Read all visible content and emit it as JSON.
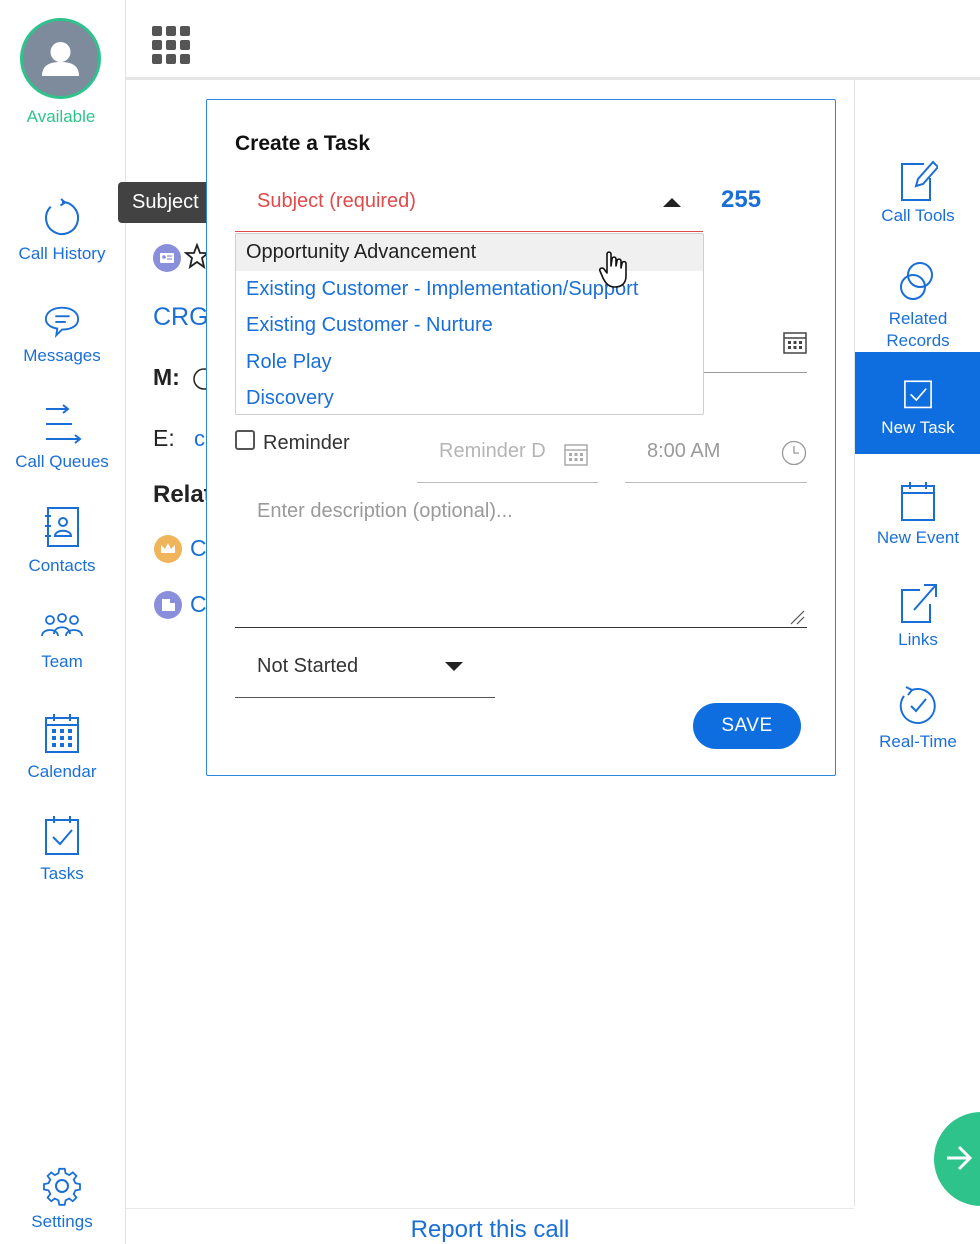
{
  "user": {
    "status": "Available"
  },
  "left_nav": {
    "call_history": "Call History",
    "messages": "Messages",
    "call_queues": "Call Queues",
    "contacts": "Contacts",
    "team": "Team",
    "calendar": "Calendar",
    "tasks": "Tasks",
    "settings": "Settings"
  },
  "right_nav": {
    "call_tools": "Call Tools",
    "related_records_1": "Related",
    "related_records_2": "Records",
    "new_task": "New Task",
    "new_event": "New Event",
    "links": "Links",
    "real_time": "Real-Time"
  },
  "background": {
    "crg": "CRG",
    "m_label": "M:",
    "e_label": "E:",
    "e_value": "c",
    "related_heading": "Relat",
    "related_item_1": "C",
    "related_item_2": "C"
  },
  "tooltip": {
    "text": "Subject"
  },
  "task_form": {
    "title": "Create a Task",
    "subject_placeholder": "Subject (required)",
    "char_count": "255",
    "subject_options": [
      "Opportunity Advancement",
      "Existing Customer - Implementation/Support",
      "Existing Customer - Nurture",
      "Role Play",
      "Discovery"
    ],
    "reminder_label": "Reminder",
    "reminder_date_placeholder": "Reminder D",
    "reminder_time": "8:00 AM",
    "description_placeholder": "Enter description (optional)...",
    "status_value": "Not Started",
    "save_label": "SAVE"
  },
  "footer": {
    "report_link": "Report this call"
  },
  "colors": {
    "accent": "#1a6fd6",
    "primary_button": "#0e6ee0",
    "available_green": "#2fc38c",
    "required_red": "#e04a4a"
  }
}
